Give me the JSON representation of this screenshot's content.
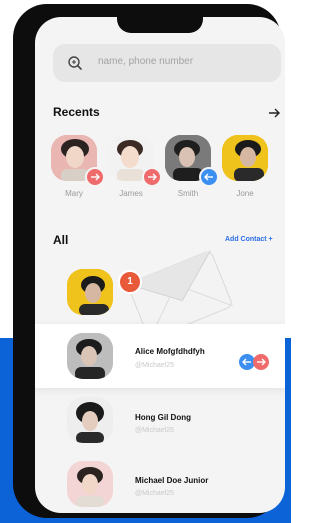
{
  "search": {
    "placeholder": "name, phone number",
    "icon": "search-icon"
  },
  "recents": {
    "title": "Recents",
    "arrow_icon": "arrow-right-icon",
    "people": [
      {
        "name": "Mary",
        "action_icon": "arrow-right-icon",
        "badge_color": "#ef6b6b"
      },
      {
        "name": "James",
        "action_icon": "arrow-right-icon",
        "badge_color": "#ef6b6b"
      },
      {
        "name": "Smith",
        "action_icon": "arrow-left-icon",
        "badge_color": "#3a8ff0"
      },
      {
        "name": "Jone",
        "action_icon": "",
        "badge_color": ""
      }
    ]
  },
  "all": {
    "title": "All",
    "add_contact": "Add Contact +",
    "notification_count": "1",
    "contacts": [
      {
        "name": "Alice Mofgfdhdfyh",
        "handle": "@Michael25"
      },
      {
        "name": "Hong Gil Dong",
        "handle": "@Michael25"
      },
      {
        "name": "Michael Doe Junior",
        "handle": "@Michael25"
      }
    ]
  },
  "colors": {
    "accent": "#2b6ee6",
    "badge_red": "#ef6b6b",
    "badge_blue": "#3a8ff0",
    "notification": "#e85a3a",
    "backdrop": "#0c63d8"
  }
}
